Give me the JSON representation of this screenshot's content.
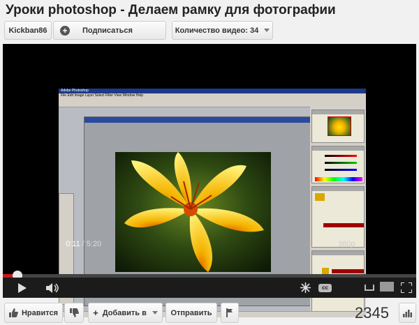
{
  "video": {
    "title": "Уроки photoshop - Делаем рамку для фотографии"
  },
  "channel": {
    "name": "Kickban86",
    "subscribe_label": "Подписаться",
    "videos_label": "Количество видео: 34"
  },
  "player": {
    "current_time": "0:11",
    "separator": " / ",
    "duration": "5:20",
    "quality": "360p",
    "progress_fraction": 0.035
  },
  "actions": {
    "like_label": "Нравится",
    "add_label": "Добавить в",
    "share_label": "Отправить",
    "view_count": "2345"
  },
  "photoshop": {
    "window_title": "Adobe Photoshop",
    "menu": "File  Edit  Image  Layer  Select  Filter  View  Window  Help",
    "doc_title": "Изображение.jpg @ 50% (RGB/8)"
  },
  "colors": {
    "accent": "#cc1818",
    "background": "#f1f1f1"
  }
}
